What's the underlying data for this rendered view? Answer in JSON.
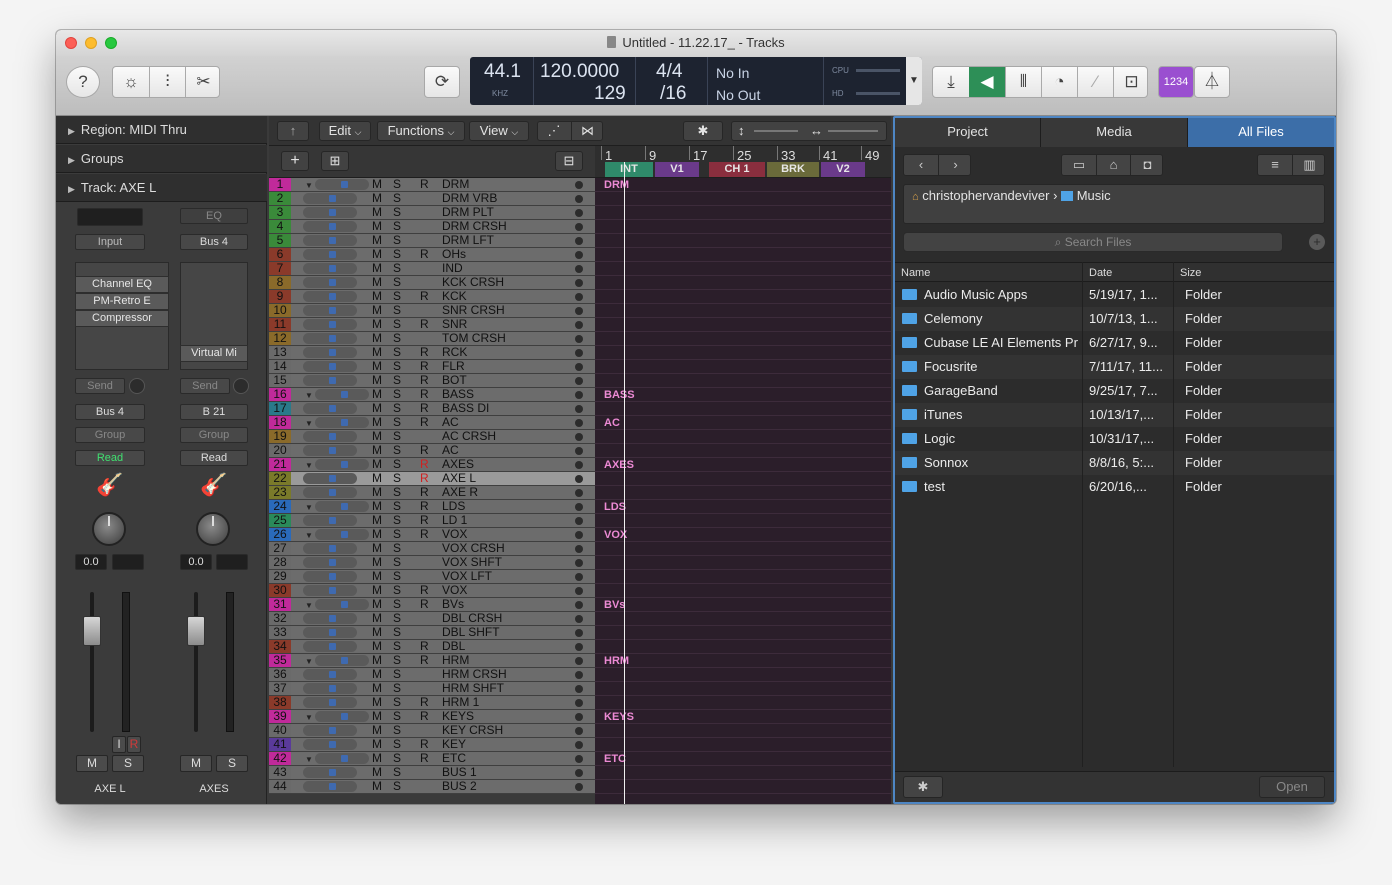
{
  "window": {
    "title": "Untitled - 11.22.17_ - Tracks"
  },
  "toolbar": {
    "help_icon": "?",
    "lcd": {
      "sample_rate": "44.1",
      "sample_rate_unit": "KHZ",
      "tempo": "120.0000",
      "bar": "129",
      "time_sig_top": "4/4",
      "time_sig_bottom": "/16",
      "midi_in": "No In",
      "midi_out": "No Out",
      "cpu_label": "CPU",
      "hd_label": "HD"
    },
    "counter_label": "1234"
  },
  "inspector": {
    "region_label": "Region: MIDI Thru",
    "groups_label": "Groups",
    "track_label": "Track:  AXE L",
    "strip1": {
      "input": "Input",
      "plugins": [
        "Channel EQ",
        "PM-Retro E",
        "Compressor"
      ],
      "send": "Send",
      "output": "Bus 4",
      "group": "Group",
      "automation": "Read",
      "volume": "0.0",
      "mute": "M",
      "solo": "S",
      "input_mon": "I",
      "record": "R",
      "name": "AXE L"
    },
    "strip2": {
      "eq": "EQ",
      "input": "Bus 4",
      "instrument": "Virtual Mi",
      "send": "Send",
      "output": "B 21",
      "group": "Group",
      "automation": "Read",
      "volume": "0.0",
      "mute": "M",
      "solo": "S",
      "name": "AXES"
    }
  },
  "tracks": {
    "menu": {
      "edit": "Edit",
      "functions": "Functions",
      "view": "View"
    },
    "add_icon": "+",
    "ruler": [
      "1",
      "9",
      "17",
      "25",
      "33",
      "41",
      "49"
    ],
    "markers": [
      {
        "label": "INT",
        "color": "#2f8a6a"
      },
      {
        "label": "V1",
        "color": "#6a3a8a"
      },
      {
        "label": "CH 1",
        "color": "#8a2e3e"
      },
      {
        "label": "BRK",
        "color": "#6a6a3a"
      },
      {
        "label": "V2",
        "color": "#6a3a8a"
      }
    ],
    "rows": [
      {
        "n": "1",
        "name": "DRM",
        "r": "R",
        "folder": true,
        "nc": "#c02a9a",
        "lane": "DRM"
      },
      {
        "n": "2",
        "name": "DRM VRB",
        "r": "",
        "nc": "#3a8a3a"
      },
      {
        "n": "3",
        "name": "DRM PLT",
        "r": "",
        "nc": "#3a8a3a"
      },
      {
        "n": "4",
        "name": "DRM CRSH",
        "r": "",
        "nc": "#3a8a3a"
      },
      {
        "n": "5",
        "name": "DRM LFT",
        "r": "",
        "nc": "#3a8a3a"
      },
      {
        "n": "6",
        "name": "OHs",
        "r": "R",
        "nc": "#8a3a2a"
      },
      {
        "n": "7",
        "name": "IND",
        "r": "",
        "nc": "#8a3a2a"
      },
      {
        "n": "8",
        "name": "KCK CRSH",
        "r": "",
        "nc": "#8a6a2a"
      },
      {
        "n": "9",
        "name": "KCK",
        "r": "R",
        "nc": "#8a3a2a"
      },
      {
        "n": "10",
        "name": "SNR CRSH",
        "r": "",
        "nc": "#8a6a2a"
      },
      {
        "n": "11",
        "name": "SNR",
        "r": "R",
        "nc": "#8a3a2a"
      },
      {
        "n": "12",
        "name": "TOM CRSH",
        "r": "",
        "nc": "#8a6a2a"
      },
      {
        "n": "13",
        "name": "RCK",
        "r": "R",
        "nc": "#6a6a6a"
      },
      {
        "n": "14",
        "name": "FLR",
        "r": "R",
        "nc": "#6a6a6a"
      },
      {
        "n": "15",
        "name": "BOT",
        "r": "R",
        "nc": "#6a6a6a"
      },
      {
        "n": "16",
        "name": "BASS",
        "r": "R",
        "folder": true,
        "nc": "#c02a9a",
        "lane": "BASS"
      },
      {
        "n": "17",
        "name": "BASS DI",
        "r": "R",
        "nc": "#2a7a8a"
      },
      {
        "n": "18",
        "name": "AC",
        "r": "R",
        "folder": true,
        "nc": "#c02a9a",
        "lane": "AC"
      },
      {
        "n": "19",
        "name": "AC CRSH",
        "r": "",
        "nc": "#8a6a2a"
      },
      {
        "n": "20",
        "name": "AC",
        "r": "R",
        "nc": "#6a6a6a"
      },
      {
        "n": "21",
        "name": "AXES",
        "r": "R",
        "red": true,
        "folder": true,
        "nc": "#c02a9a",
        "lane": "AXES"
      },
      {
        "n": "22",
        "name": "AXE L",
        "r": "R",
        "red": true,
        "sel": true,
        "nc": "#7a7a2a"
      },
      {
        "n": "23",
        "name": "AXE R",
        "r": "R",
        "nc": "#7a7a2a"
      },
      {
        "n": "24",
        "name": "LDS",
        "r": "R",
        "folder": true,
        "nc": "#2a6aba",
        "lane": "LDS"
      },
      {
        "n": "25",
        "name": "LD 1",
        "r": "R",
        "nc": "#2a8a5a"
      },
      {
        "n": "26",
        "name": "VOX",
        "r": "R",
        "folder": true,
        "nc": "#2a6aba",
        "lane": "VOX"
      },
      {
        "n": "27",
        "name": "VOX CRSH",
        "r": "",
        "nc": "#6a6a6a"
      },
      {
        "n": "28",
        "name": "VOX SHFT",
        "r": "",
        "nc": "#6a6a6a"
      },
      {
        "n": "29",
        "name": "VOX LFT",
        "r": "",
        "nc": "#6a6a6a"
      },
      {
        "n": "30",
        "name": "VOX",
        "r": "R",
        "nc": "#8a3a2a"
      },
      {
        "n": "31",
        "name": "BVs",
        "r": "R",
        "folder": true,
        "nc": "#c02a9a",
        "lane": "BVs"
      },
      {
        "n": "32",
        "name": "DBL CRSH",
        "r": "",
        "nc": "#6a6a6a"
      },
      {
        "n": "33",
        "name": "DBL SHFT",
        "r": "",
        "nc": "#6a6a6a"
      },
      {
        "n": "34",
        "name": "DBL",
        "r": "R",
        "nc": "#8a3a2a"
      },
      {
        "n": "35",
        "name": "HRM",
        "r": "R",
        "folder": true,
        "nc": "#c02a9a",
        "lane": "HRM"
      },
      {
        "n": "36",
        "name": "HRM CRSH",
        "r": "",
        "nc": "#6a6a6a"
      },
      {
        "n": "37",
        "name": "HRM SHFT",
        "r": "",
        "nc": "#6a6a6a"
      },
      {
        "n": "38",
        "name": "HRM 1",
        "r": "R",
        "nc": "#8a3a2a"
      },
      {
        "n": "39",
        "name": "KEYS",
        "r": "R",
        "folder": true,
        "nc": "#c02a9a",
        "lane": "KEYS"
      },
      {
        "n": "40",
        "name": "KEY CRSH",
        "r": "",
        "nc": "#6a6a6a"
      },
      {
        "n": "41",
        "name": "KEY",
        "r": "R",
        "nc": "#5a3a9a"
      },
      {
        "n": "42",
        "name": "ETC",
        "r": "R",
        "folder": true,
        "nc": "#c02a9a",
        "lane": "ETC"
      },
      {
        "n": "43",
        "name": "BUS 1",
        "r": "",
        "nc": "#6a6a6a"
      },
      {
        "n": "44",
        "name": "BUS 2",
        "r": "",
        "nc": "#6a6a6a"
      }
    ],
    "mute_label": "M",
    "solo_label": "S"
  },
  "browser": {
    "tabs": [
      "Project",
      "Media",
      "All Files"
    ],
    "active_tab": "All Files",
    "path_user": "christophervandeviver",
    "path_sep": "›",
    "path_folder": "Music",
    "search_placeholder": "Search Files",
    "columns": {
      "name": "Name",
      "date": "Date",
      "size": "Size"
    },
    "files": [
      {
        "name": "Audio Music Apps",
        "date": "5/19/17, 1...",
        "size": "Folder"
      },
      {
        "name": "Celemony",
        "date": "10/7/13, 1...",
        "size": "Folder"
      },
      {
        "name": "Cubase LE AI Elements Pr",
        "date": "6/27/17, 9...",
        "size": "Folder"
      },
      {
        "name": "Focusrite",
        "date": "7/11/17, 11...",
        "size": "Folder"
      },
      {
        "name": "GarageBand",
        "date": "9/25/17, 7...",
        "size": "Folder"
      },
      {
        "name": "iTunes",
        "date": "10/13/17,...",
        "size": "Folder"
      },
      {
        "name": "Logic",
        "date": "10/31/17,...",
        "size": "Folder"
      },
      {
        "name": "Sonnox",
        "date": "8/8/16, 5:...",
        "size": "Folder"
      },
      {
        "name": "test",
        "date": "6/20/16,...",
        "size": "Folder"
      }
    ],
    "open_label": "Open"
  }
}
